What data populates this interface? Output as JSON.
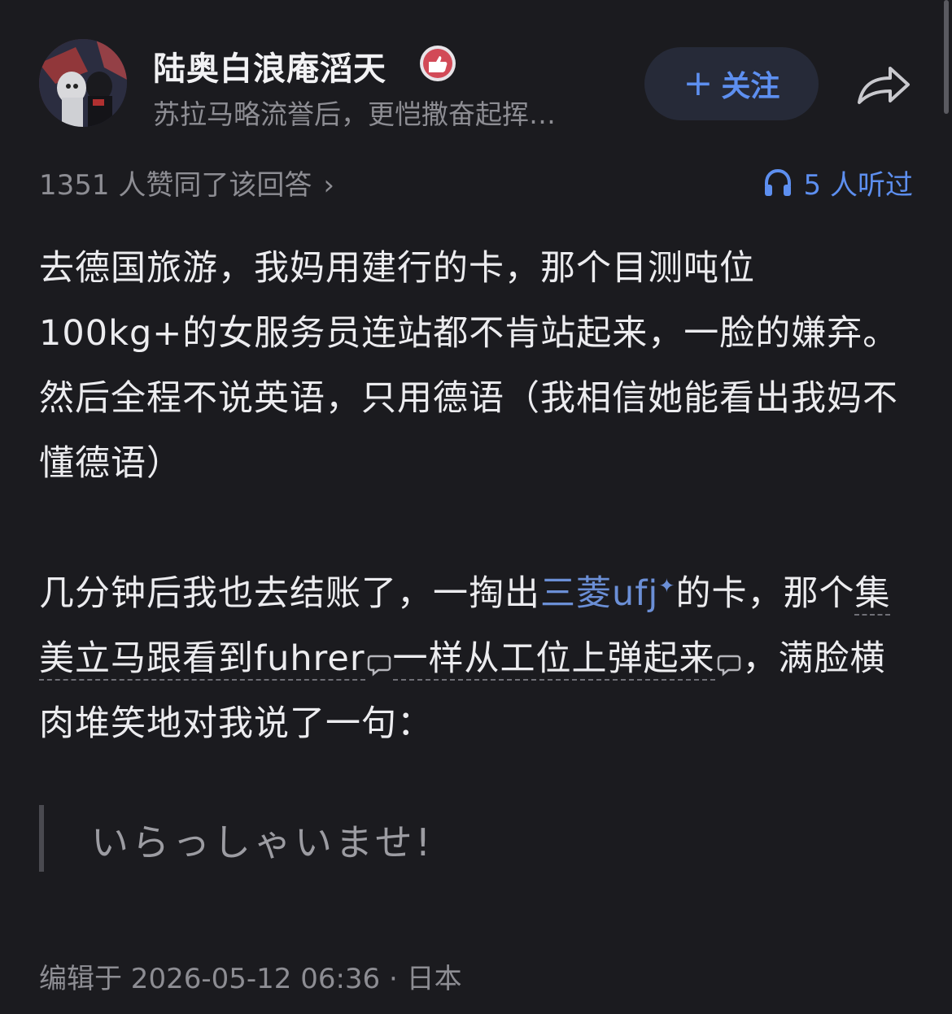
{
  "author": {
    "name": "陆奥白浪庵滔天",
    "bio": "苏拉马略流誉后，更恺撒奋起挥…",
    "avatar_icon": "star-wars-avatar",
    "badge_icon": "thumbs-up-badge-icon"
  },
  "actions": {
    "follow_label": "关注",
    "follow_icon": "+",
    "share_icon": "share-arrow-icon"
  },
  "stats": {
    "upvote_text": "1351 人赞同了该回答",
    "upvote_chevron": "›",
    "listen_text": "5 人听过"
  },
  "content": {
    "p1": "去德国旅游，我妈用建行的卡，那个目测吨位100kg+的女服务员连站都不肯站起来，一脸的嫌弃。然后全程不说英语，只用德语（我相信她能看出我妈不懂德语）",
    "p2_part1": "几分钟后我也去结账了，一掏出",
    "p2_link": "三菱ufj",
    "p2_sparkle": "✦",
    "p2_part2": "的卡，那个",
    "p2_annot1": "集美立马跟看到fuhrer",
    "p2_annot2": "一样从工位上弹起来",
    "p2_part3": "，满脸横肉堆笑地对我说了一句：",
    "quote": "いらっしゃいませ!"
  },
  "footer": {
    "meta": "编辑于 2026-05-12 06:36 · 日本"
  },
  "colors": {
    "background": "#1b1b1f",
    "accent": "#5d8ff0",
    "link": "#6b8fd6",
    "muted": "#8d8d93"
  }
}
